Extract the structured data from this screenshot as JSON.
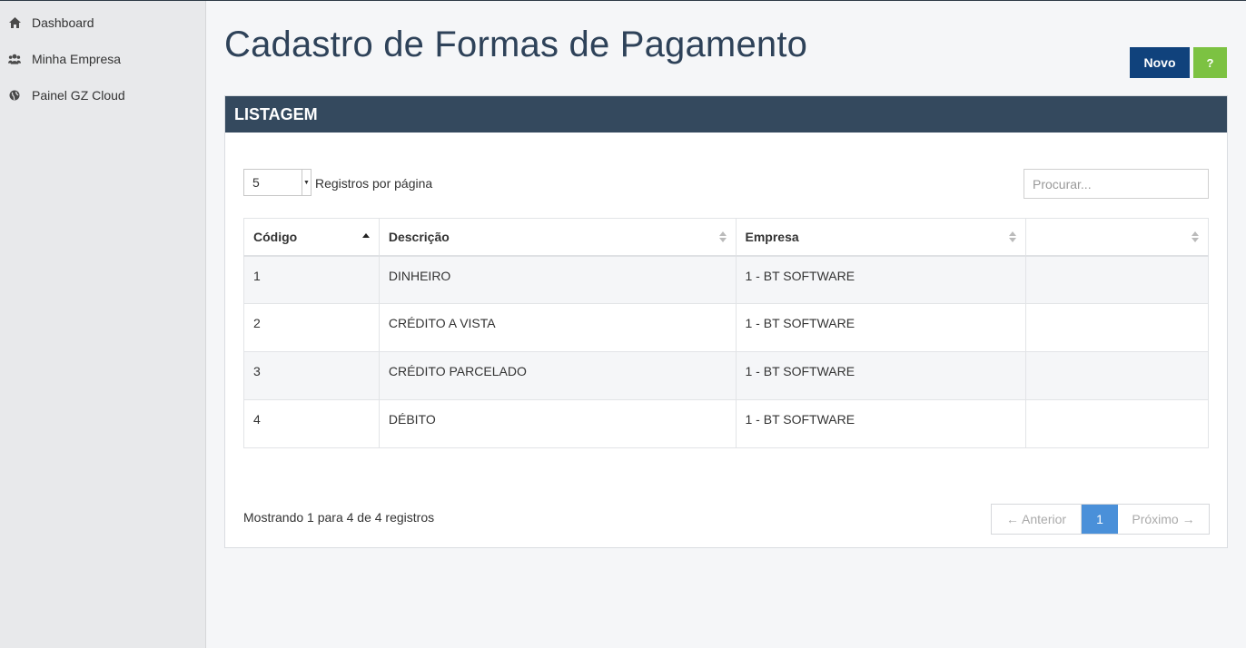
{
  "sidebar": {
    "items": [
      {
        "label": "Dashboard",
        "icon": "home-icon"
      },
      {
        "label": "Minha Empresa",
        "icon": "users-icon"
      },
      {
        "label": "Painel GZ Cloud",
        "icon": "globe-icon"
      }
    ]
  },
  "header": {
    "title": "Cadastro de Formas de Pagamento",
    "novo_label": "Novo",
    "help_label": "?"
  },
  "panel": {
    "title": "LISTAGEM",
    "page_length": "5",
    "page_length_label": "Registros por página",
    "search_placeholder": "Procurar..."
  },
  "table": {
    "columns": [
      "Código",
      "Descrição",
      "Empresa",
      ""
    ],
    "rows": [
      [
        "1",
        "DINHEIRO",
        "1 - BT SOFTWARE",
        ""
      ],
      [
        "2",
        "CRÉDITO A VISTA",
        "1 - BT SOFTWARE",
        ""
      ],
      [
        "3",
        "CRÉDITO PARCELADO",
        "1 - BT SOFTWARE",
        ""
      ],
      [
        "4",
        "DÉBITO",
        "1 - BT SOFTWARE",
        ""
      ]
    ]
  },
  "footer": {
    "info": "Mostrando 1 para 4 de 4 registros",
    "prev_label": "← Anterior",
    "current_page": "1",
    "next_label": "Próximo →"
  },
  "colors": {
    "title": "#2e4259",
    "panel_header": "#34495e",
    "novo_button": "#10427c",
    "help_button": "#7cc242",
    "active_page": "#4a90d9"
  }
}
